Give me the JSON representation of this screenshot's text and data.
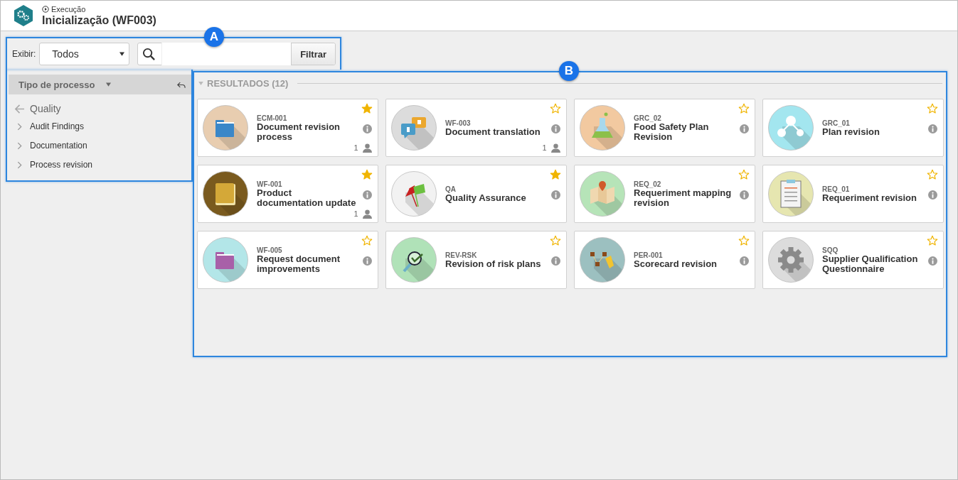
{
  "header": {
    "breadcrumb": "Execução",
    "title": "Inicialização (WF003)"
  },
  "toolbar": {
    "show_label": "Exibir:",
    "show_value": "Todos",
    "filter_button": "Filtrar"
  },
  "sidebar": {
    "heading": "Tipo de processo",
    "parent": "Quality",
    "items": [
      {
        "label": "Audit Findings"
      },
      {
        "label": "Documentation"
      },
      {
        "label": "Process revision"
      }
    ]
  },
  "results": {
    "heading": "RESULTADOS (12)",
    "expanded": true,
    "cards": [
      {
        "code": "ECM-001",
        "name": "Document revision process",
        "favorite": true,
        "count": "1",
        "color": "#e8cdb0"
      },
      {
        "code": "WF-003",
        "name": "Document translation",
        "favorite": false,
        "count": "1",
        "color": "#dcdcdc"
      },
      {
        "code": "GRC_02",
        "name": "Food Safety Plan Revision",
        "favorite": false,
        "color": "#f2c9a0"
      },
      {
        "code": "GRC_01",
        "name": "Plan revision",
        "favorite": false,
        "color": "#a3e6ef"
      },
      {
        "code": "WF-001",
        "name": "Product documentation update",
        "favorite": true,
        "count": "1",
        "color": "#7a5a1e"
      },
      {
        "code": "QA",
        "name": "Quality Assurance",
        "favorite": true,
        "color": "#f2f2f2"
      },
      {
        "code": "REQ_02",
        "name": "Requeriment mapping revision",
        "favorite": false,
        "color": "#b6e4b8"
      },
      {
        "code": "REQ_01",
        "name": "Requeriment revision",
        "favorite": false,
        "color": "#e6e6b0"
      },
      {
        "code": "WF-005",
        "name": "Request document improvements",
        "favorite": false,
        "color": "#b3e6e8"
      },
      {
        "code": "REV-RSK",
        "name": "Revision of risk plans",
        "favorite": false,
        "color": "#b0e2b8"
      },
      {
        "code": "PER-001",
        "name": "Scorecard revision",
        "favorite": false,
        "color": "#9cc0c0"
      },
      {
        "code": "SQQ",
        "name": "Supplier Qualification Questionnaire",
        "favorite": false,
        "color": "#dcdcdc"
      }
    ]
  },
  "callouts": [
    {
      "label": "A"
    },
    {
      "label": "B"
    }
  ]
}
